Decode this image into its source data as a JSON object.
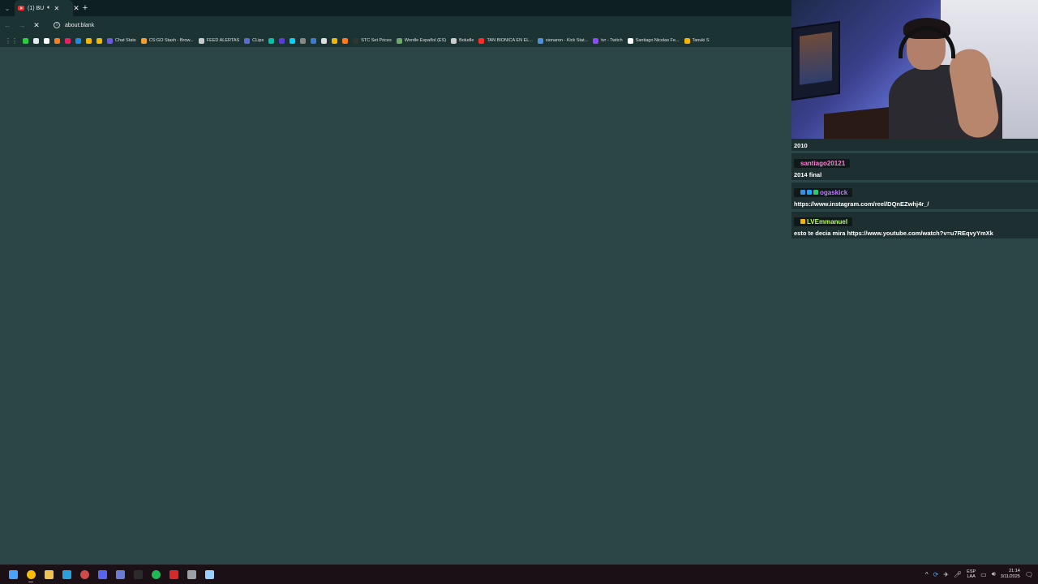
{
  "browser": {
    "tab": {
      "title": "(1) BU",
      "audio_icon": "speaker-icon",
      "close": "✕"
    },
    "tab_close_extra": "✕",
    "new_tab": "+",
    "address": "about:blank"
  },
  "bookmarks": [
    {
      "label": "",
      "color": "#2ecc40"
    },
    {
      "label": "",
      "color": "#e8eaed"
    },
    {
      "label": "",
      "color": "#ffffff"
    },
    {
      "label": "",
      "color": "#ff7a1a"
    },
    {
      "label": "",
      "color": "#e91e63"
    },
    {
      "label": "",
      "color": "#1e88e5"
    },
    {
      "label": "",
      "color": "#f5b400"
    },
    {
      "label": "",
      "color": "#f5b400"
    },
    {
      "label": "Chat Stats",
      "color": "#6b5bd6"
    },
    {
      "label": "CS:GO Stash - Brow...",
      "color": "#f0a030"
    },
    {
      "label": "FEED ALERTAS",
      "color": "#c9c9c9"
    },
    {
      "label": "CLips",
      "color": "#5b6bd6"
    },
    {
      "label": "",
      "color": "#00c2a8"
    },
    {
      "label": "",
      "color": "#5b3dd6"
    },
    {
      "label": "",
      "color": "#00d1ff"
    },
    {
      "label": "",
      "color": "#888888"
    },
    {
      "label": "",
      "color": "#3a7bd5"
    },
    {
      "label": "",
      "color": "#dddddd"
    },
    {
      "label": "",
      "color": "#f5b400"
    },
    {
      "label": "",
      "color": "#ff7a1a"
    },
    {
      "label": "STC Set Prices",
      "color": "#333333"
    },
    {
      "label": "Wordle Español (ES)",
      "color": "#6aaa64"
    },
    {
      "label": "Boludle",
      "color": "#cccccc"
    },
    {
      "label": "TAN BIONICA EN EL...",
      "color": "#ff2a2a"
    },
    {
      "label": "sionaron - Kick Stat...",
      "color": "#4a90e2"
    },
    {
      "label": "tvr - Twitch",
      "color": "#9146ff"
    },
    {
      "label": "Santiago Nicolas Fe...",
      "color": "#ffffff"
    },
    {
      "label": "Tanuki S",
      "color": "#f5b400"
    }
  ],
  "chat": {
    "messages": [
      {
        "user": "",
        "text": "2010"
      },
      {
        "user": "santiago20121",
        "user_color": "#ff7fd6",
        "text": "2014 final"
      },
      {
        "user": "ogaskick",
        "user_color": "#c07bff",
        "badges": [
          "#3a8ee6",
          "#1aa3ff",
          "#2ecc71"
        ],
        "text": "https://www.instagram.com/reel/DQnEZwhj4r_/"
      },
      {
        "user": "LVEmmanuel",
        "user_color": "#b5ff5a",
        "badges": [
          "#f5b400"
        ],
        "text": "esto te decia mira https://www.youtube.com/watch?v=u7REqvyYmXk"
      }
    ]
  },
  "taskbar": {
    "apps": [
      {
        "name": "start-button",
        "color": "#4aa3ff"
      },
      {
        "name": "chrome-app",
        "color": "#fbbc05",
        "running": true
      },
      {
        "name": "file-explorer-app",
        "color": "#f2c14e"
      },
      {
        "name": "telegram-app",
        "color": "#2aa1da"
      },
      {
        "name": "app-obs",
        "color": "#d04a4a"
      },
      {
        "name": "discord-app",
        "color": "#5865f2"
      },
      {
        "name": "app-monitor",
        "color": "#6a7bd6"
      },
      {
        "name": "app-box",
        "color": "#2b2b2b"
      },
      {
        "name": "spotify-app",
        "color": "#1db954"
      },
      {
        "name": "app-red",
        "color": "#d62828"
      },
      {
        "name": "app-gear",
        "color": "#9aa0a6"
      },
      {
        "name": "app-puzzle",
        "color": "#9ad0ff"
      }
    ],
    "lang_top": "ESP",
    "lang_bottom": "LAA",
    "time": "21:14",
    "date": "3/11/2025"
  }
}
